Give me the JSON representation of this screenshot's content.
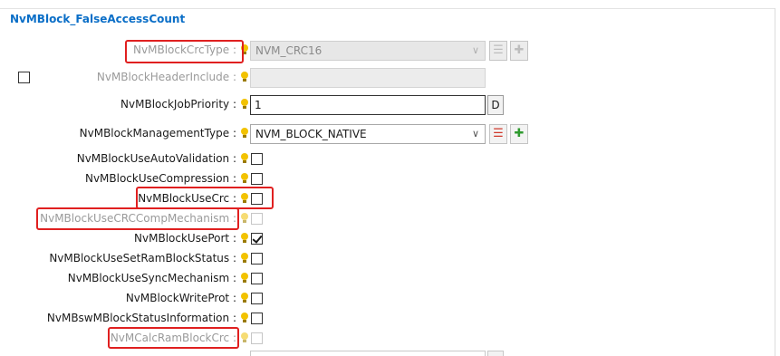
{
  "header": {
    "title": "NvMBlock_FalseAccessCount"
  },
  "rows": {
    "crc_type": {
      "label": "NvMBlockCrcType :",
      "value": "NVM_CRC16"
    },
    "header_include": {
      "label": "NvMBlockHeaderInclude :",
      "value": ""
    },
    "job_priority": {
      "label": "NvMBlockJobPriority :",
      "value": "1",
      "button": "D"
    },
    "management_type": {
      "label": "NvMBlockManagementType :",
      "value": "NVM_BLOCK_NATIVE"
    },
    "auto_validation": {
      "label": "NvMBlockUseAutoValidation :",
      "checked": false
    },
    "use_compression": {
      "label": "NvMBlockUseCompression :",
      "checked": false
    },
    "use_crc": {
      "label": "NvMBlockUseCrc :",
      "checked": false
    },
    "crc_comp_mechanism": {
      "label": "NvMBlockUseCRCCompMechanism :",
      "checked": false
    },
    "use_port": {
      "label": "NvMBlockUsePort :",
      "checked": true
    },
    "set_ram_block_status": {
      "label": "NvMBlockUseSetRamBlockStatus :",
      "checked": false
    },
    "sync_mechanism": {
      "label": "NvMBlockUseSyncMechanism :",
      "checked": false
    },
    "write_prot": {
      "label": "NvMBlockWriteProt :",
      "checked": false
    },
    "status_information": {
      "label": "NvMBswMBlockStatusInformation :",
      "checked": false
    },
    "calc_ram_block_crc": {
      "label": "NvMCalcRamBlockCrc :",
      "checked": false
    }
  },
  "icons": {
    "info": "lightbulb-icon",
    "dropdown": "chevron-down-icon",
    "list": "list-icon",
    "add": "plus-icon"
  },
  "colors": {
    "title": "#0a6ec7",
    "highlight": "#e02020",
    "bulb": "#f2c200"
  }
}
